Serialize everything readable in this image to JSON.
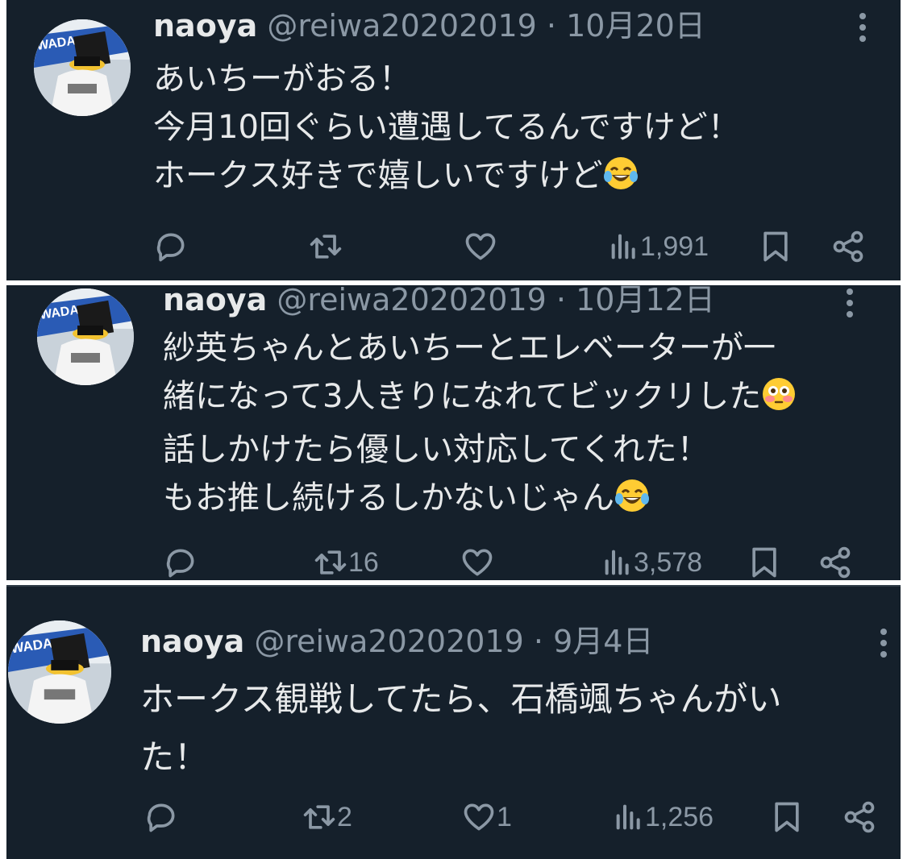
{
  "tweets": [
    {
      "name": "naoya",
      "handle": "@reiwa20202019",
      "separator": "·",
      "date": "10月20日",
      "lines": [
        "あいちーがおる！",
        "今月10回ぐらい遭遇してるんですけど！",
        "ホークス好きで嬉しいですけど"
      ],
      "emoji": "face-with-tears-of-joy",
      "reply_count": "",
      "retweet_count": "",
      "like_count": "",
      "views": "1,991"
    },
    {
      "name": "naoya",
      "handle": "@reiwa20202019",
      "separator": "·",
      "date": "10月12日",
      "lines": [
        "紗英ちゃんとあいちーとエレベーターが一",
        "緒になって3人きりになれてビックリした",
        "話しかけたら優しい対応してくれた！",
        "もお推し続けるしかないじゃん"
      ],
      "emoji": "flushed-face / face-with-tears-of-joy",
      "reply_count": "",
      "retweet_count": "16",
      "like_count": "",
      "views": "3,578"
    },
    {
      "name": "naoya",
      "handle": "@reiwa20202019",
      "separator": "·",
      "date": "9月4日",
      "lines": [
        "ホークス観戦してたら、石橋颯ちゃんがい",
        "た！"
      ],
      "reply_count": "",
      "retweet_count": "2",
      "like_count": "1",
      "views": "1,256"
    }
  ],
  "icons": {
    "reply": "speech-bubble-icon",
    "retweet": "retweet-arrows-icon",
    "like": "heart-icon",
    "views": "bar-chart-icon",
    "bookmark": "bookmark-icon",
    "share": "share-icon",
    "more": "vertical-ellipsis-icon"
  },
  "colors": {
    "background": "#15202b",
    "text": "#e7e9ea",
    "secondary": "#8b98a5"
  }
}
